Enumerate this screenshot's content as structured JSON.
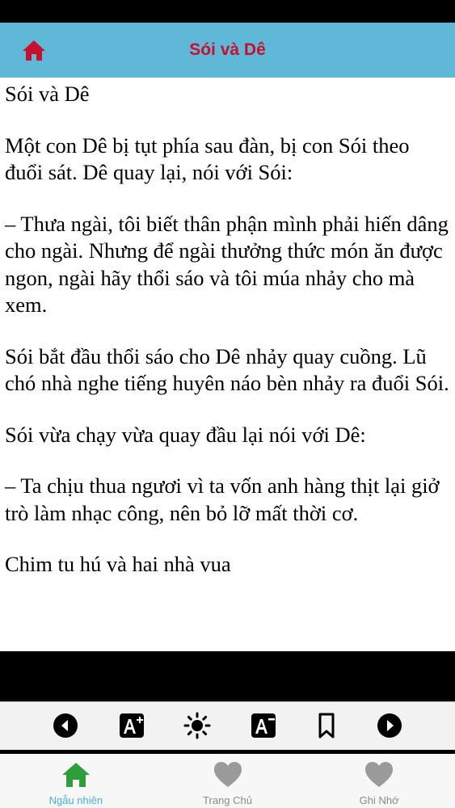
{
  "header": {
    "title": "Sói và Dê",
    "home_icon": "home-icon",
    "title_color": "#c8102e",
    "bar_color": "#5fb8d8"
  },
  "story": {
    "paragraphs": [
      "Sói và Dê",
      "Một con Dê bị tụt phía sau đàn, bị con Sói theo đuổi sát. Dê quay lại, nói với Sói:",
      "– Thưa ngài, tôi biết thân phận mình phải hiến dâng cho ngài. Nhưng để ngài thưởng thức món ăn được ngon, ngài hãy thổi sáo và tôi múa nhảy cho mà xem.",
      "Sói bắt đầu thổi sáo cho Dê nhảy quay cuồng. Lũ chó nhà nghe tiếng huyên náo bèn nhảy ra đuổi Sói.",
      "Sói vừa chạy vừa quay đầu lại nói với Dê:",
      "– Ta chịu thua ngươi vì ta vốn anh hàng thịt lại giở trò làm nhạc công, nên bỏ lỡ mất thời cơ.",
      "Chim tu hú và hai nhà vua"
    ]
  },
  "toolbar": {
    "icons": [
      "previous-icon",
      "font-increase-icon",
      "brightness-icon",
      "font-decrease-icon",
      "bookmark-icon",
      "next-icon"
    ]
  },
  "tabs": [
    {
      "label": "Ngẫu nhiên",
      "icon": "home-icon",
      "active": true,
      "color": "#2e9e3a"
    },
    {
      "label": "Trang Chủ",
      "icon": "heart-icon",
      "active": false,
      "color": "#9a9a9a"
    },
    {
      "label": "Ghi Nhớ",
      "icon": "heart-icon",
      "active": false,
      "color": "#9a9a9a"
    }
  ]
}
